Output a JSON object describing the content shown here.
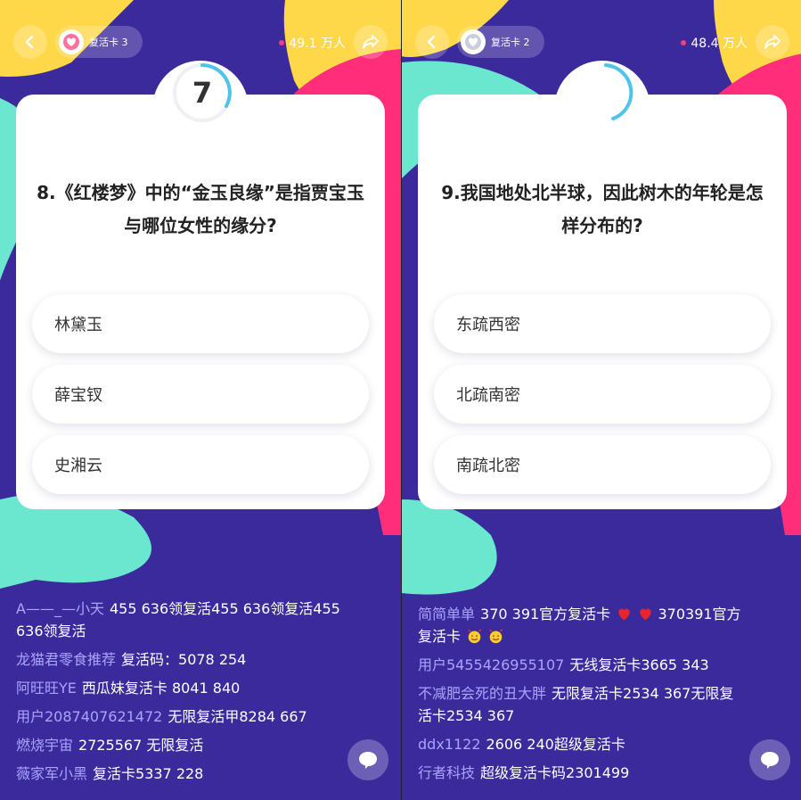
{
  "left": {
    "revive_card_label": "复活卡 3",
    "online_count": "49.1 万人",
    "timer_number": "7",
    "question": "8.《红楼梦》中的“金玉良缘”是指贾宝玉与哪位女性的缘分?",
    "options": [
      "林黛玉",
      "薛宝钗",
      "史湘云"
    ],
    "comments": [
      {
        "user": "A——_—小天",
        "text": "455 636领复活455 636领复活455 636领复活"
      },
      {
        "user": "龙猫君零食推荐",
        "text": "复活码：5078 254"
      },
      {
        "user": "阿旺旺YE",
        "text": "西瓜妹复活卡 8041 840"
      },
      {
        "user": "用户2087407621472",
        "text": "无限复活甲8284 667"
      },
      {
        "user": "燃烧宇宙",
        "text": "2725567 无限复活"
      },
      {
        "user": "薇家军小黑",
        "text": "复活卡5337 228"
      }
    ]
  },
  "right": {
    "revive_card_label": "复活卡 2",
    "online_count": "48.4 万人",
    "question": "9.我国地处北半球，因此树木的年轮是怎样分布的?",
    "options": [
      "东疏西密",
      "北疏南密",
      "南疏北密"
    ],
    "comments": [
      {
        "user": "简简单单",
        "text": "370 391官方复活卡",
        "text2": "370391官方复活卡"
      },
      {
        "user": "用户5455426955107",
        "text": "无线复活卡3665 343"
      },
      {
        "user": "不减肥会死的丑大胖",
        "text": "无限复活卡2534 367无限复活卡2534 367"
      },
      {
        "user": "ddx1122",
        "text": "2606 240超级复活卡"
      },
      {
        "user": "行者科技",
        "text": "超级复活卡码2301499"
      }
    ]
  },
  "icons": [
    "back-arrow-icon",
    "heart-icon",
    "share-icon",
    "chat-bubble-icon",
    "red-heart-emoji",
    "smiling-hearts-emoji"
  ],
  "colors": {
    "background_purple": "#3b2a9c",
    "teal_shape": "#6be6cf",
    "pink_shape": "#ff2d7a",
    "yellow_shape": "#ffd84a",
    "timer_blue": "#4fc3e8",
    "username_color": "#a9a4ff"
  }
}
